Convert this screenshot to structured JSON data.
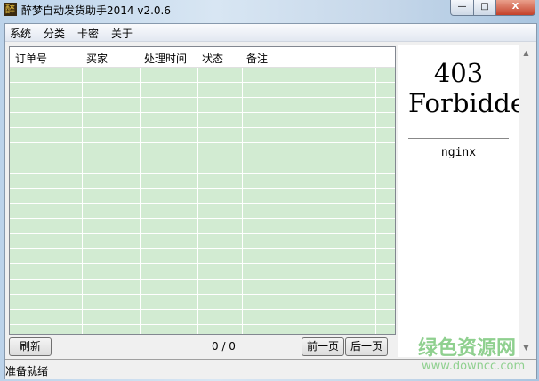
{
  "window": {
    "title": "醉梦自动发货助手2014  v2.0.6",
    "icon_char": "醉",
    "min": "—",
    "max": "□",
    "close": "X"
  },
  "menu": [
    "系统",
    "分类",
    "卡密",
    "关于"
  ],
  "table": {
    "columns": [
      "订单号",
      "买家",
      "处理时间",
      "状态",
      "备注"
    ],
    "rows": []
  },
  "web": {
    "heading1": "403",
    "heading2": "Forbidden",
    "server": "nginx"
  },
  "footer": {
    "refresh": "刷新",
    "page_info": "0 / 0",
    "prev": "前一页",
    "next": "后一页"
  },
  "status": "准备就绪",
  "watermark": {
    "cn": "绿色资源网",
    "url": "www.downcc.com"
  }
}
